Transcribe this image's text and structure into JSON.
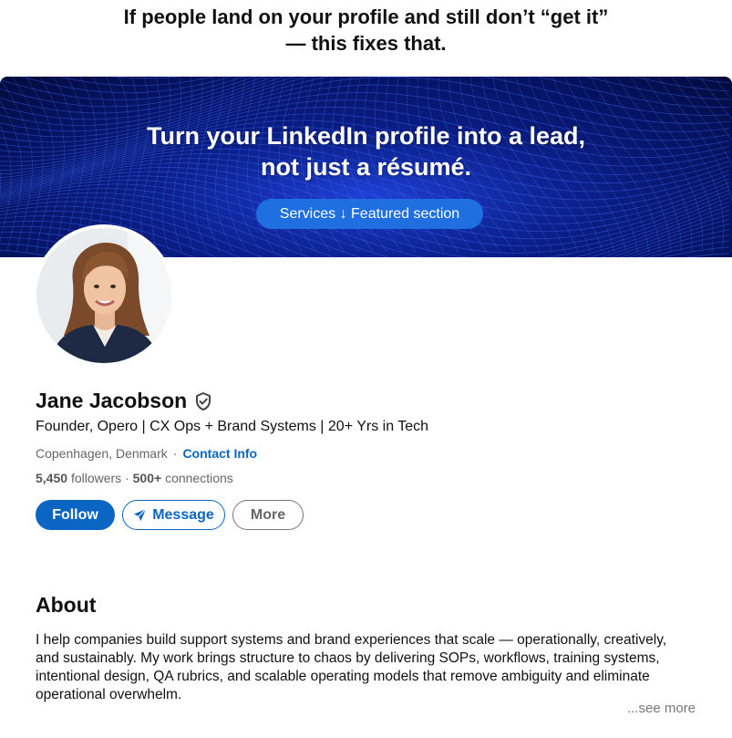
{
  "headline": {
    "line1": "If people land on your profile and still don’t “get it”",
    "line2": "— this fixes that."
  },
  "banner": {
    "line1": "Turn your LinkedIn profile into a lead,",
    "line2": "not just a résumé.",
    "pill_label": "Services ↓ Featured section",
    "colors": {
      "bg_dark": "#061467",
      "grid": "#2f6bff",
      "pill": "#1f6fe0"
    }
  },
  "profile": {
    "name": "Jane Jacobson",
    "verified_icon": "shield-check-icon",
    "tagline": "Founder, Opero | CX Ops + Brand Systems | 20+ Yrs in Tech",
    "location": "Copenhagen, Denmark",
    "separator": "·",
    "contact_label": "Contact Info",
    "followers_count": "5,450",
    "followers_label": "followers",
    "connections_count": "500+",
    "connections_label": "connections"
  },
  "actions": {
    "follow_label": "Follow",
    "message_label": "Message",
    "message_icon": "send-icon",
    "more_label": "More"
  },
  "about": {
    "title": "About",
    "text": "I help companies build support systems and brand experiences that scale — operationally, creatively, and sustainably. My work brings structure to chaos by delivering SOPs, workflows, training systems, intentional design, QA rubrics, and scalable operating models that remove ambiguity and eliminate operational overwhelm.",
    "see_more": "...see more"
  },
  "colors": {
    "accent": "#0a66c2",
    "muted_text": "#666666"
  }
}
